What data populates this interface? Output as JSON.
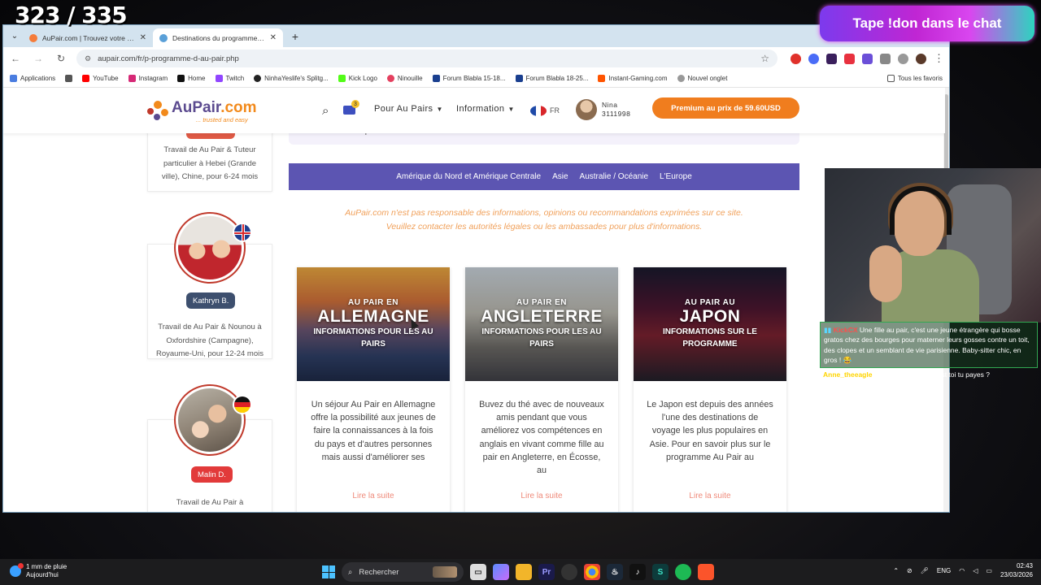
{
  "stream": {
    "counter": "323 / 335",
    "banner": "Tape !don dans le chat"
  },
  "browser": {
    "tabs": [
      {
        "title": "AuPair.com | Trouvez votre fille",
        "active": false
      },
      {
        "title": "Destinations du programme Au",
        "active": true
      }
    ],
    "url": "aupair.com/fr/p-programme-d-au-pair.php",
    "bookmarks": [
      "Applications",
      "YouTube",
      "Instagram",
      "Home",
      "Twitch",
      "NinhaYeslife's Splitg...",
      "Kick Logo",
      "Ninouille",
      "Forum Blabla 15-18...",
      "Forum Blabla 18-25...",
      "Instant-Gaming.com",
      "Nouvel onglet"
    ],
    "bookmarks_right": "Tous les favoris"
  },
  "site": {
    "logo_name_a": "AuPair",
    "logo_name_b": ".com",
    "logo_tag": "... trusted and easy",
    "mail_badge": "3",
    "menu_au_pairs": "Pour Au Pairs",
    "menu_information": "Information",
    "lang": "FR",
    "user_name": "Nina",
    "user_id": "3111998",
    "premium_label": "Premium au prix de 59.60USD"
  },
  "profiles": [
    {
      "desc": "Travail de Au Pair & Tuteur particulier à Hebei (Grande ville), Chine, pour 6-24 mois"
    },
    {
      "name": "Kathryn B.",
      "desc": "Travail de Au Pair & Nounou à Oxfordshire (Campagne), Royaume-Uni, pour 12-24 mois",
      "flag": "uk-flag"
    },
    {
      "name": "Malin D.",
      "desc": "Travail de Au Pair à",
      "flag": "germany-flag"
    }
  ],
  "content": {
    "visa_text": "décidera si la personne a le droit ou non à ce visa.",
    "regions": [
      "Amérique du Nord et Amérique Centrale",
      "Asie",
      "Australie / Océanie",
      "L'Europe"
    ],
    "disclaimer_1": "AuPair.com n'est pas responsable des informations, opinions ou recommandations exprimées sur ce site.",
    "disclaimer_2": "Veuillez contacter les autorités légales ou les ambassades pour plus d'informations.",
    "cards": [
      {
        "small": "AU PAIR EN",
        "big": "ALLEMAGNE",
        "sub": "INFORMATIONS POUR LES AU PAIRS",
        "text": "Un séjour Au Pair en Allemagne offre la possibilité aux jeunes de faire la connaissances à la fois du pays et d'autres personnes mais aussi d'améliorer ses",
        "more": "Lire la suite"
      },
      {
        "small": "AU PAIR EN",
        "big": "ANGLETERRE",
        "sub": "INFORMATIONS POUR LES AU PAIRS",
        "text": "Buvez du thé avec de nouveaux amis pendant que vous améliorez vos compétences en anglais en vivant comme fille au pair en Angleterre, en Écosse, au",
        "more": "Lire la suite"
      },
      {
        "small": "AU PAIR AU",
        "big": "JAPON",
        "sub": "INFORMATIONS SUR LE PROGRAMME",
        "text": "Le Japon est depuis des années l'une des destinations de voyage les plus populaires en Asie. Pour en savoir plus sur le programme Au Pair au",
        "more": "Lire la suite"
      }
    ]
  },
  "chat": {
    "user1": "KickCX",
    "msg1": "Une fille au pair, c'est une jeune étrangère qui bosse gratos chez des bourges pour materner leurs gosses contre un toit, des clopes et un semblant de vie parisienne. Baby-sitter chic, en gros ! 😂",
    "user2": "Anne_theeagle",
    "msg2": ": et le billet d'avion c'est toi tu payes ?"
  },
  "taskbar": {
    "weather_1": "1 mm de pluie",
    "weather_2": "Aujourd'hui",
    "search": "Rechercher",
    "lang": "ENG",
    "time": "02:43",
    "date": "23/03/2026"
  }
}
